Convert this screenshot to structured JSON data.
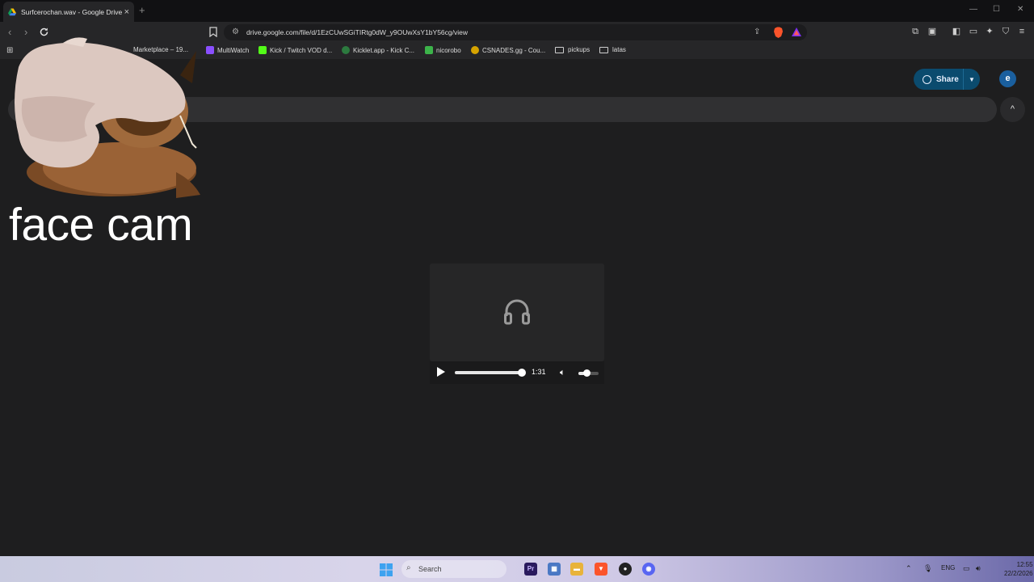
{
  "browser": {
    "tab_title": "Surfcerochan.wav - Google Drive",
    "tab_close": "×",
    "new_tab": "+",
    "window_controls": {
      "minimize": "—",
      "maximize": "☐",
      "close": "✕"
    },
    "url": "drive.google.com/file/d/1EzCUwSGiTIRtg0dW_y9OUwXsY1bY56cg/view"
  },
  "bookmarks": [
    {
      "label": "Marketplace – 19...",
      "icon": "marketplace-icon"
    },
    {
      "label": "MultiWatch",
      "icon": "multiwatch-icon"
    },
    {
      "label": "Kick / Twitch VOD d...",
      "icon": "kick-icon"
    },
    {
      "label": "Kicklet.app - Kick C...",
      "icon": "kicklet-icon"
    },
    {
      "label": "nicorobo",
      "icon": "nicorobo-icon"
    },
    {
      "label": "CSNADES.gg - Cou...",
      "icon": "csnades-icon"
    },
    {
      "label": "pickups",
      "icon": "folder-icon"
    },
    {
      "label": "latas",
      "icon": "folder-icon"
    }
  ],
  "drive": {
    "share_label": "Share",
    "avatar_initial": "e",
    "collapse_symbol": "^"
  },
  "overlay": {
    "caption": "face cam"
  },
  "player": {
    "time": "1:31",
    "progress": 1.0,
    "volume": 0.3
  },
  "taskbar": {
    "search_label": "Search",
    "language": "ENG",
    "time": "12:55",
    "date": "22/2/2026"
  },
  "colors": {
    "accent_share": "#0b4b6e",
    "avatar": "#1a5f9e",
    "background": "#1e1e1f"
  }
}
